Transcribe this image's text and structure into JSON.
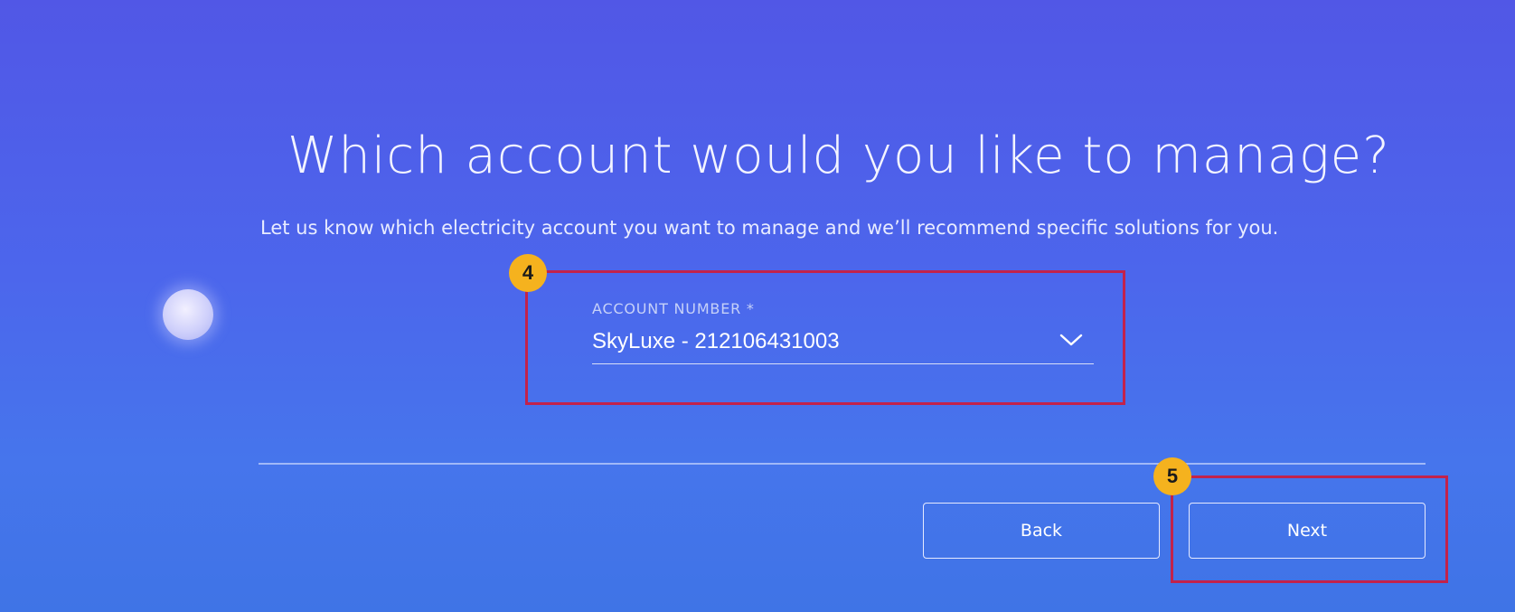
{
  "page": {
    "title": "Which account would you like to manage?",
    "subtitle": "Let us know which electricity account you want to manage and we’ll recommend specific solutions for you."
  },
  "annotations": {
    "step_4": "4",
    "step_5": "5"
  },
  "account_field": {
    "label": "ACCOUNT NUMBER *",
    "selected_value": "SkyLuxe - 212106431003",
    "icon": "chevron-down-icon"
  },
  "actions": {
    "back_label": "Back",
    "next_label": "Next"
  },
  "colors": {
    "background_top": "#5157e6",
    "background_bottom": "#3f74e6",
    "highlight": "#c2224b",
    "badge": "#f5b21e"
  }
}
